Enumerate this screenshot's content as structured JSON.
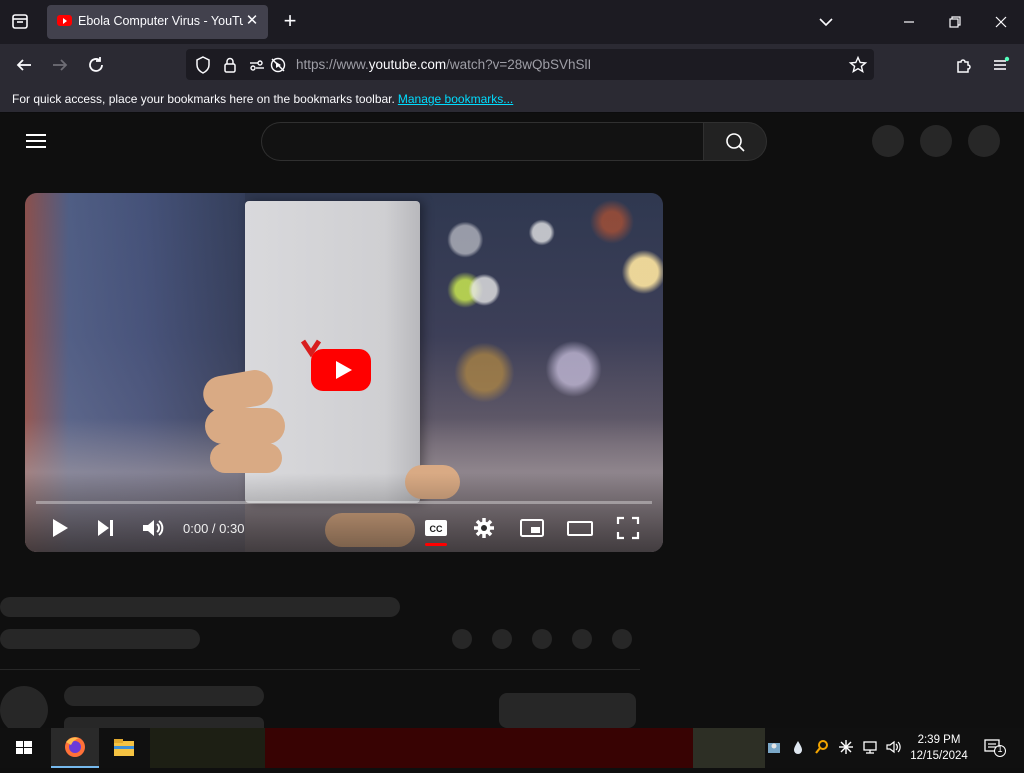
{
  "browser": {
    "tab": {
      "title": "Ebola Computer Virus - YouTube",
      "close_glyph": "✕"
    },
    "new_tab_glyph": "+",
    "window_controls": {
      "list_all_tabs": "⌄",
      "minimize": "—",
      "restore": "❐",
      "close": "✕"
    },
    "url": {
      "prefix": "https://www.",
      "host": "youtube.com",
      "path": "/watch?v=28wQbSVhSlI"
    },
    "bookmarks_bar": {
      "text": "For quick access, place your bookmarks here on the bookmarks toolbar.",
      "link": "Manage bookmarks..."
    }
  },
  "player": {
    "time": "0:00 / 0:30",
    "cc_label": "CC",
    "progress": 0.0
  },
  "taskbar": {
    "time": "2:39 PM",
    "date": "12/15/2024",
    "notification_count": "1"
  },
  "colors": {
    "accent_link": "#00ddff",
    "youtube_red": "#ff0000",
    "taskbar_highlight": "#76b9ed"
  }
}
